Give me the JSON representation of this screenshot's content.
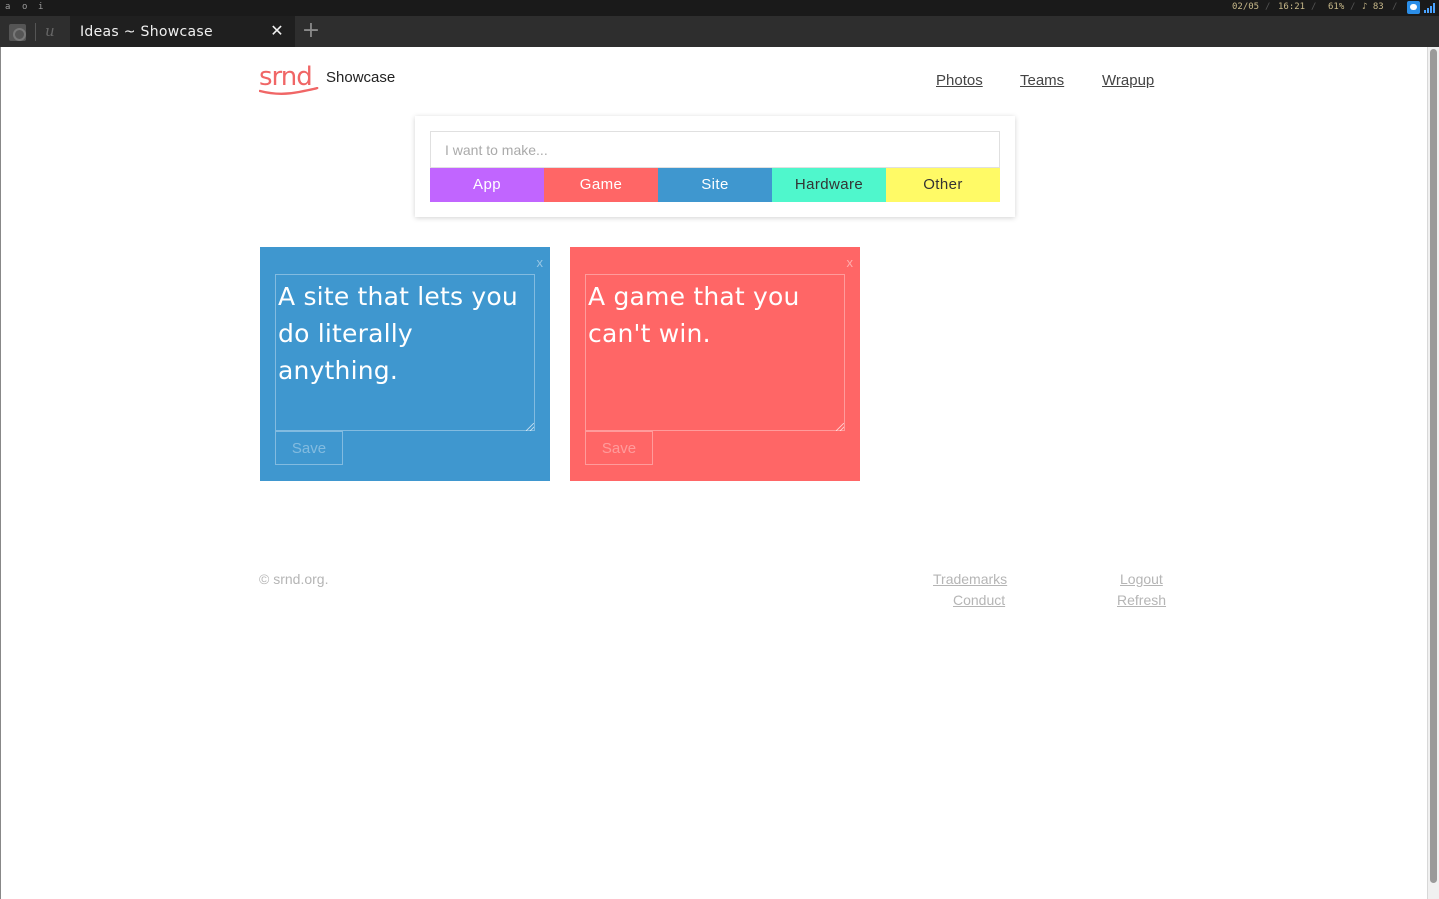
{
  "system_bar": {
    "workspaces": [
      "a",
      "o",
      "i"
    ],
    "date": "02/05",
    "time": "16:21",
    "battery": "61%",
    "volume": "♪ 83",
    "tray_icons": [
      "chat-icon",
      "signal-icon"
    ]
  },
  "browser": {
    "tab_title": "Ideas ~ Showcase",
    "tab_close": "✕",
    "new_tab": "+",
    "icons": [
      "gear-icon",
      "browser-logo-icon"
    ]
  },
  "header": {
    "logo_text": "srnd",
    "brand_name": "Showcase",
    "nav": [
      "Photos",
      "Teams",
      "Wrapup"
    ]
  },
  "composer": {
    "placeholder": "I want to make...",
    "value": "",
    "categories": [
      {
        "label": "App",
        "color": "#c165ff",
        "text_color": "#ffffff"
      },
      {
        "label": "Game",
        "color": "#ff6666",
        "text_color": "#ffffff"
      },
      {
        "label": "Site",
        "color": "#3f97cf",
        "text_color": "#ffffff"
      },
      {
        "label": "Hardware",
        "color": "#4ff7cc",
        "text_color": "#333333"
      },
      {
        "label": "Other",
        "color": "#fffa66",
        "text_color": "#333333"
      }
    ]
  },
  "ideas": [
    {
      "text": "A site that lets you do literally anything.",
      "category": "Site",
      "color": "#3f97cf",
      "close": "x",
      "save_label": "Save"
    },
    {
      "text": "A game that you can't win.",
      "category": "Game",
      "color": "#ff6666",
      "close": "x",
      "save_label": "Save"
    }
  ],
  "footer": {
    "copyright": "© srnd.org.",
    "links_left": [
      "Trademarks",
      "Conduct"
    ],
    "links_right": [
      "Logout",
      "Refresh"
    ]
  }
}
